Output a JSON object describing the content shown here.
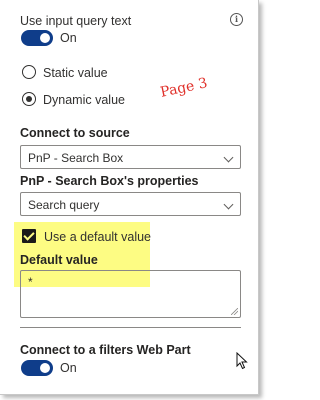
{
  "use_input_query": {
    "label": "Use input query text",
    "toggle_state": "On",
    "info_icon": "info-icon"
  },
  "query_mode": {
    "options": [
      {
        "label": "Static value",
        "selected": false
      },
      {
        "label": "Dynamic value",
        "selected": true
      }
    ]
  },
  "annotation": "Page 3",
  "connect_source": {
    "label": "Connect to source",
    "value": "PnP - Search Box"
  },
  "properties": {
    "label": "PnP - Search Box's properties",
    "value": "Search query"
  },
  "default_value": {
    "checkbox_label": "Use a default value",
    "checked": true,
    "field_label": "Default value",
    "field_value": "*"
  },
  "filters": {
    "label": "Connect to a filters Web Part",
    "toggle_state": "On"
  },
  "colors": {
    "toggle_on": "#0f3d8a",
    "highlight": "#fdfc83",
    "annotation": "#e0302a"
  }
}
